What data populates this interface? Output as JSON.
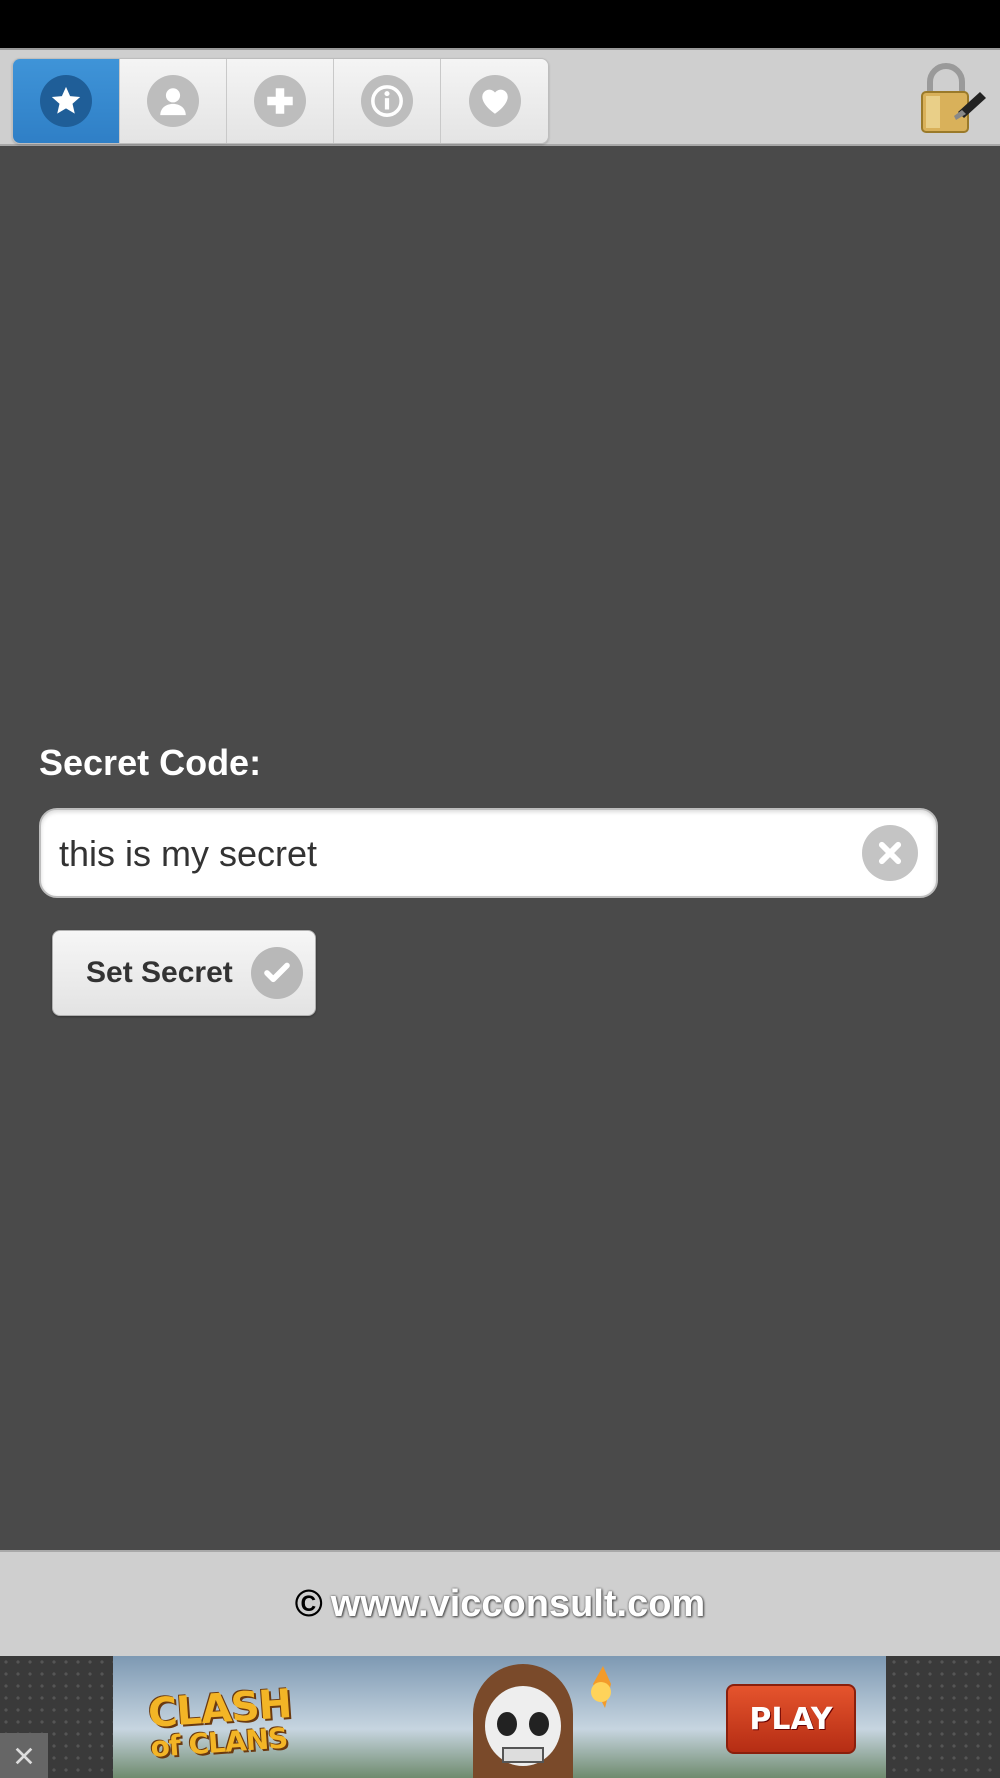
{
  "toolbar": {
    "tabs": [
      {
        "icon": "star-icon",
        "active": true
      },
      {
        "icon": "user-icon",
        "active": false
      },
      {
        "icon": "plus-icon",
        "active": false
      },
      {
        "icon": "info-icon",
        "active": false
      },
      {
        "icon": "heart-icon",
        "active": false
      }
    ],
    "lock_icon": "padlock-icon"
  },
  "form": {
    "label": "Secret Code:",
    "input_value": "this is my secret",
    "button_label": "Set Secret"
  },
  "footer": {
    "copyright_symbol": "©",
    "text": "www.vicconsult.com"
  },
  "ad": {
    "title_line1": "CLASH",
    "title_line2": "of CLANS",
    "play_label": "PLAY"
  },
  "colors": {
    "accent": "#2f7fc6",
    "background": "#4a4a4a",
    "bar": "#cfcfcf"
  }
}
